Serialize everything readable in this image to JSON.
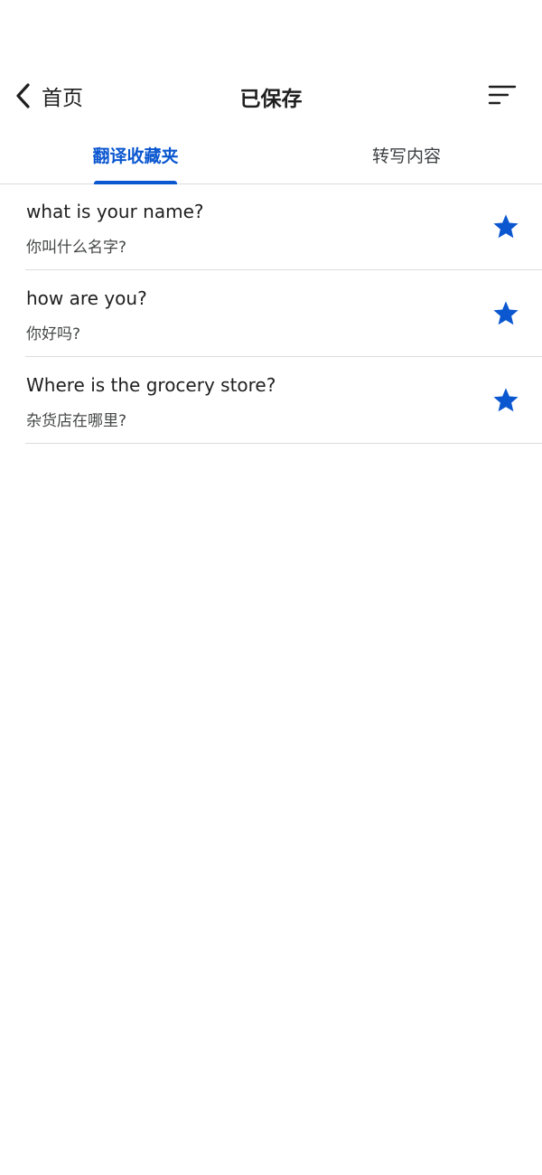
{
  "header": {
    "back_label": "首页",
    "title": "已保存",
    "back_icon": "chevron-left-icon",
    "sort_icon": "sort-icon"
  },
  "tabs": [
    {
      "label": "翻译收藏夹",
      "active": true
    },
    {
      "label": "转写内容",
      "active": false
    }
  ],
  "saved_items": [
    {
      "source": "what is your name?",
      "translation": "你叫什么名字?",
      "starred": true
    },
    {
      "source": "how are you?",
      "translation": "你好吗?",
      "starred": true
    },
    {
      "source": "Where is the grocery store?",
      "translation": "杂货店在哪里?",
      "starred": true
    }
  ],
  "colors": {
    "accent": "#0b57d0",
    "divider": "#dadce0",
    "text_primary": "#1f1f1f",
    "text_secondary": "#444746"
  }
}
